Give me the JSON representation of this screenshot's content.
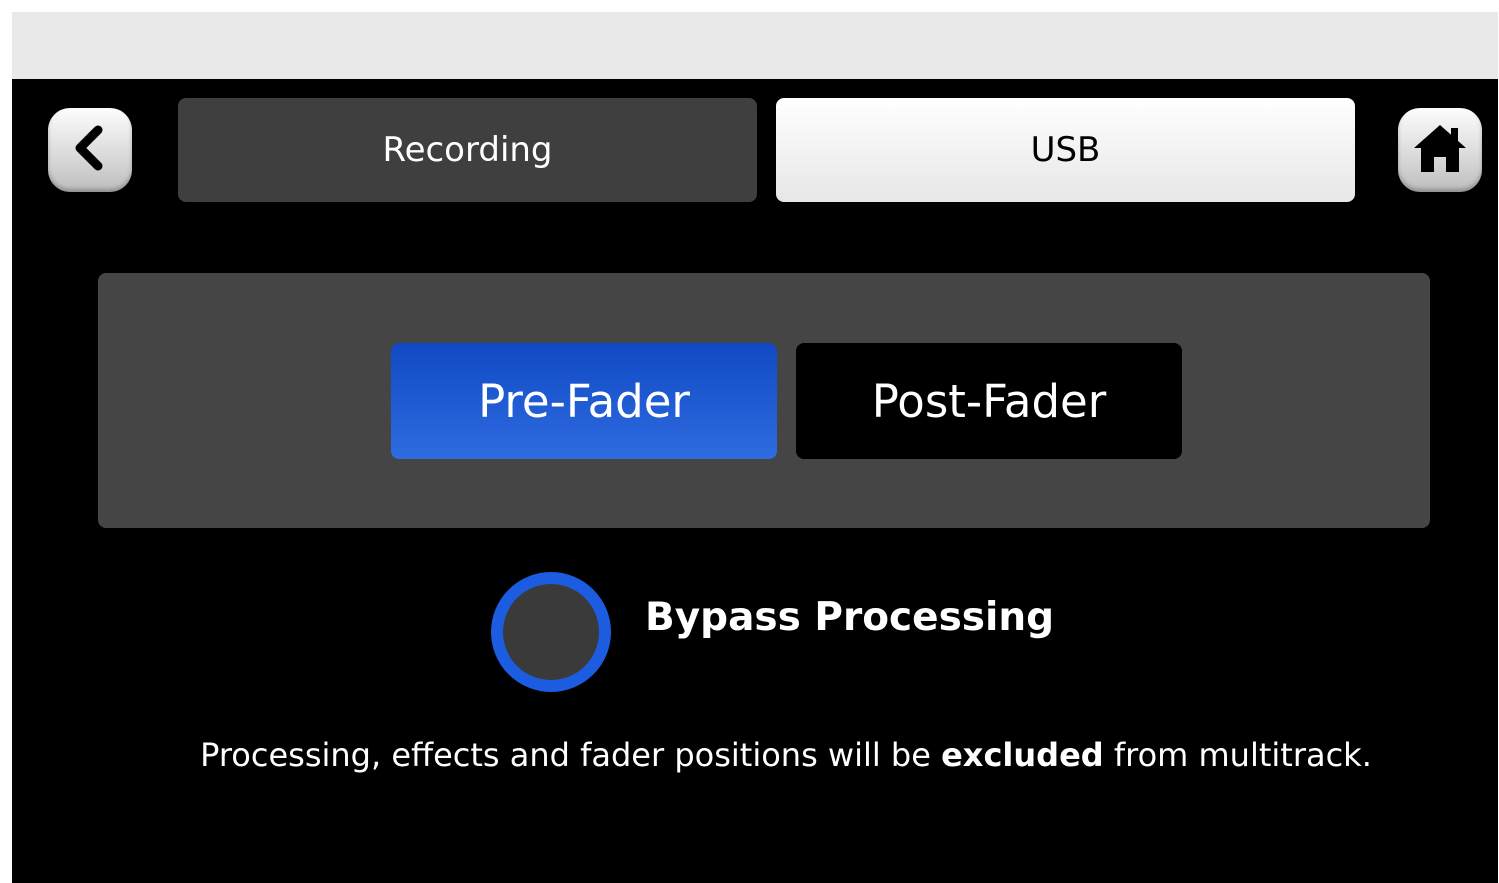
{
  "nav": {
    "back_icon": "chevron-left-icon",
    "home_icon": "home-icon"
  },
  "tabs": [
    {
      "label": "Recording",
      "selected": false
    },
    {
      "label": "USB",
      "selected": true
    }
  ],
  "tap_point": {
    "options": [
      {
        "label": "Pre-Fader",
        "selected": true
      },
      {
        "label": "Post-Fader",
        "selected": false
      }
    ]
  },
  "bypass": {
    "label": "Bypass Processing",
    "enabled": false
  },
  "note": {
    "before": "Processing, effects and fader positions will be ",
    "emphasis": "excluded",
    "after": " from multitrack."
  },
  "colors": {
    "accent": "#1c5ce0",
    "selected_segment": "#2563d9",
    "panel": "#454545",
    "background": "#000000",
    "tab_inactive": "#3f3f3f",
    "tab_active": "#f5f5f5"
  }
}
